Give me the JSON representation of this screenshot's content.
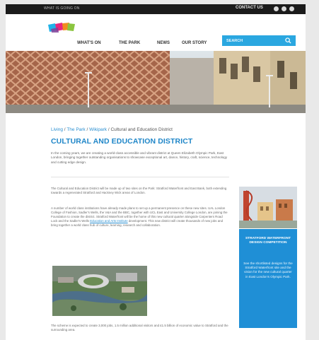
{
  "topbar": {
    "left_text": "WHAT IS GOING ON",
    "contact_label": "CONTACT US",
    "social_icons": [
      "facebook-icon",
      "twitter-icon",
      "instagram-icon"
    ]
  },
  "nav": {
    "items": [
      "WHAT'S ON",
      "THE PARK",
      "NEWS",
      "OUR STORY"
    ],
    "search_placeholder": "SEARCH"
  },
  "breadcrumb": {
    "links": [
      "Living",
      "The Park",
      "Wikipark"
    ],
    "current": "Cultural and Education District"
  },
  "main": {
    "title": "CULTURAL AND EDUCATION DISTRICT",
    "intro": "In the coming years, we are creating a world-class accessible and vibrant district at Queen Elizabeth Olympic Park, East London, bringing together outstanding organisations to showcase exceptional art, dance, history, craft, science, technology and cutting edge design.",
    "paragraph_1": "The Cultural and Education District will be made up of two sites on the Park: Stratford Waterfront and East Bank, both extending towards a regenerated Stratford and Hackney Wick areas of London.",
    "paragraph_2_a": "A number of world class institutions have already made plans to set up a permanent presence on these new sites. UAL London College of Fashion, Sadler's Wells, the V&A and the BBC, together with UCL East and University College London, are joining the Foundation to create the district. Stratford Waterfront will be the home of this new cultural quarter alongside Carpenters Road Lock and the Sadler's Wells ",
    "paragraph_2_link": "Education and Arts Institute",
    "paragraph_2_b": " development. This new district will create thousands of new jobs and bring together a world class hub of culture, learning, research and collaboration.",
    "paragraph_3": "The scheme is expected to create 3,000 jobs, 1.5 million additional visitors and £1.5 billion of economic value to Stratford and the surrounding area."
  },
  "sidebar": {
    "promo_heading": "STRATFORD WATERFRONT DESIGN COMPETITION",
    "promo_body": "See the shortlisted designs for the Stratford Waterfront site and the vision for the new cultural quarter in East London's Olympic Park."
  },
  "colors": {
    "accent": "#2aa7e0",
    "title_blue": "#1f86c8",
    "promo_blue": "#1f8fd6",
    "topbar": "#1b1b1b"
  }
}
